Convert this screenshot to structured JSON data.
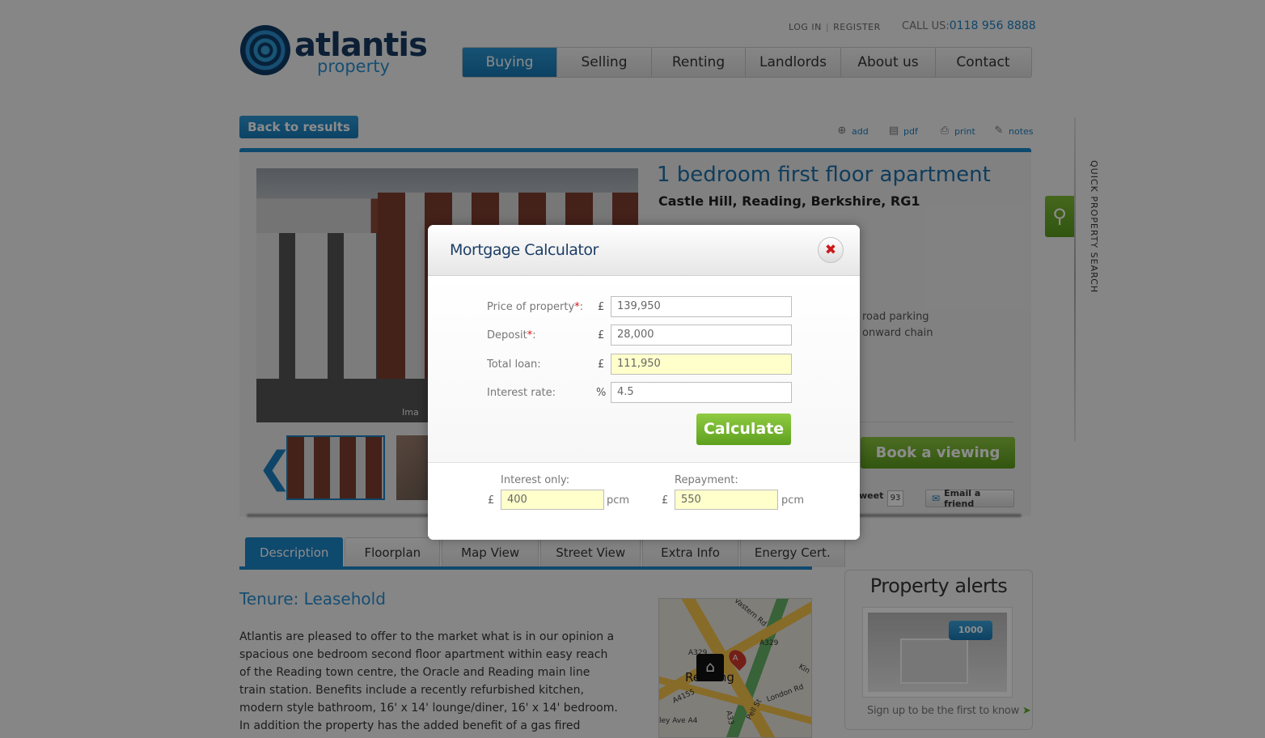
{
  "brand": {
    "name": "atlantis",
    "sub": "property"
  },
  "toplinks": {
    "login": "LOG IN",
    "register": "REGISTER",
    "call_label": "CALL US:",
    "phone": "0118 956 8888"
  },
  "nav": [
    "Buying",
    "Selling",
    "Renting",
    "Landlords",
    "About us",
    "Contact"
  ],
  "toolbar": {
    "back": "Back to results",
    "add": "add",
    "pdf": "pdf",
    "print": "print",
    "notes": "notes"
  },
  "property": {
    "title": "1 bedroom first floor apartment",
    "address": "Castle Hill, Reading, Berkshire, RG1",
    "features": [
      "road parking",
      "onward chain"
    ],
    "image_caption": "Ima",
    "book_viewing": "Book a viewing",
    "tweet": "weet",
    "tweet_count": "93",
    "email_friend": "Email a friend"
  },
  "side_tab": {
    "label": "QUICK PROPERTY SEARCH"
  },
  "tabs": [
    "Description",
    "Floorplan",
    "Map View",
    "Street View",
    "Extra Info",
    "Energy Cert."
  ],
  "description": {
    "tenure": "Tenure: Leasehold",
    "text": "Atlantis are pleased to offer to the market what is in our opinion a spacious one bedroom second floor apartment within easy reach of the Reading town centre, the Oracle and Reading main line train station. Benefits include a recently refurbished kitchen, modern style bathroom, 16' x 14' lounge/diner, 16' x 14' bedroom. In addition the property has the added benefit of a gas fired central heating system,"
  },
  "map": {
    "city": "Reading",
    "roads": [
      "Vastern Rd",
      "A329",
      "A329",
      "A4155",
      "London Rd",
      "A33",
      "Pell St",
      "ley Ave A4",
      "Kin"
    ],
    "marker": "A"
  },
  "alerts": {
    "title": "Property alerts",
    "badge": "1000",
    "signup": "Sign up to be the first to know"
  },
  "modal": {
    "title": "Mortgage Calculator",
    "price_label": "Price of property",
    "deposit_label": "Deposit",
    "required": "*",
    "colon": ":",
    "loan_label": "Total loan:",
    "rate_label": "Interest rate:",
    "currency": "£",
    "percent": "%",
    "price": "139,950",
    "deposit": "28,000",
    "loan": "111,950",
    "rate": "4.5",
    "calculate": "Calculate",
    "interest_only_label": "Interest only:",
    "repayment_label": "Repayment:",
    "interest_only": "400",
    "repayment": "550",
    "pcm": "pcm"
  }
}
